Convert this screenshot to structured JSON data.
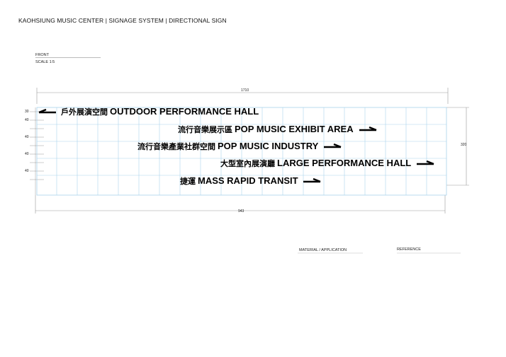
{
  "header": {
    "title": "KAOHSIUNG MUSIC CENTER | SIGNAGE SYSTEM |  DIRECTIONAL SIGN"
  },
  "view": {
    "label": "FRONT",
    "scale": "SCALE 1:5"
  },
  "dimensions": {
    "width": "1710",
    "inner_width": "943",
    "height": "320",
    "row_heights": [
      "30",
      "40",
      "40",
      "40",
      "40"
    ]
  },
  "sign": {
    "items": [
      {
        "zh": "戶外展演空間",
        "en": "OUTDOOR PERFORMANCE HALL",
        "arrow": "left"
      },
      {
        "zh": "流行音樂展示區",
        "en": "POP MUSIC EXHIBIT AREA",
        "arrow": "right"
      },
      {
        "zh": "流行音樂產業社群空間",
        "en": "POP MUSIC INDUSTRY",
        "arrow": "right"
      },
      {
        "zh": "大型室內展演廳",
        "en": "LARGE PERFORMANCE HALL",
        "arrow": "right"
      },
      {
        "zh": "捷運",
        "en": "MASS RAPID TRANSIT",
        "arrow": "right"
      }
    ]
  },
  "footer": {
    "material_label": "MATERIAL / APPLICATION",
    "reference_label": "REFERENCE"
  },
  "colors": {
    "grid": "#a9d3ec",
    "line": "#999999",
    "text": "#000000"
  }
}
